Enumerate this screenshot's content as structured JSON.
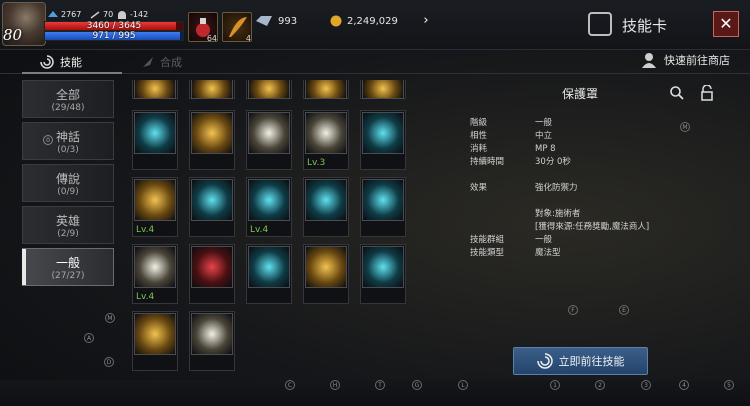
{
  "player": {
    "level": "80",
    "hp": "3460 / 3645",
    "hp_fraction": 0.95,
    "mp": "971 / 995",
    "mp_fraction": 0.98,
    "stat_a": "2767",
    "stat_b": "70",
    "stat_c": "-142"
  },
  "potions": [
    {
      "count": "64",
      "color": "#b0272b"
    },
    {
      "count": "4",
      "color": "#b8741f"
    }
  ],
  "currency": {
    "gems": "993",
    "gold": "2,249,029"
  },
  "window": {
    "title": "技能卡",
    "close": "✕"
  },
  "tabs": {
    "skills": "技能",
    "craft": "合成",
    "shop": "快速前往商店"
  },
  "sidebar": [
    {
      "name": "全部",
      "count": "(29/48)"
    },
    {
      "name": "神話",
      "count": "(0/3)",
      "badge": "0"
    },
    {
      "name": "傳說",
      "count": "(0/9)"
    },
    {
      "name": "英雄",
      "count": "(2/9)"
    },
    {
      "name": "一般",
      "count": "(27/27)",
      "selected": true
    }
  ],
  "cards": [
    {
      "icon": "skill-partial-icon-1",
      "tone": "gold",
      "lv": ""
    },
    {
      "icon": "skill-partial-icon-2",
      "tone": "gold",
      "lv": ""
    },
    {
      "icon": "skill-partial-icon-3",
      "tone": "gold",
      "lv": ""
    },
    {
      "icon": "skill-partial-icon-4",
      "tone": "gold",
      "lv": ""
    },
    {
      "icon": "skill-partial-icon-5",
      "tone": "gold",
      "lv": ""
    },
    {
      "icon": "cycle-arrows-icon",
      "tone": "cyan",
      "lv": ""
    },
    {
      "icon": "crown-sparkle-icon",
      "tone": "gold",
      "lv": ""
    },
    {
      "icon": "winged-heart-icon",
      "tone": "white",
      "lv": ""
    },
    {
      "icon": "guardian-shield-icon",
      "tone": "white",
      "lv": "Lv.3"
    },
    {
      "icon": "glowing-sword-icon",
      "tone": "cyan",
      "lv": ""
    },
    {
      "icon": "sword-burst-icon",
      "tone": "gold",
      "lv": "Lv.4"
    },
    {
      "icon": "sun-gear-icon",
      "tone": "cyan",
      "lv": ""
    },
    {
      "icon": "whirlwind-icon",
      "tone": "cyan",
      "lv": "Lv.4"
    },
    {
      "icon": "cross-shield-icon",
      "tone": "cyan",
      "lv": ""
    },
    {
      "icon": "sword-clock-icon",
      "tone": "cyan",
      "lv": ""
    },
    {
      "icon": "holy-sword-icon",
      "tone": "white",
      "lv": "Lv.4"
    },
    {
      "icon": "red-book-icon",
      "tone": "red",
      "lv": ""
    },
    {
      "icon": "blue-book-icon",
      "tone": "cyan",
      "lv": ""
    },
    {
      "icon": "fire-orb-icon",
      "tone": "gold",
      "lv": ""
    },
    {
      "icon": "scroll-swirl-icon",
      "tone": "cyan",
      "lv": ""
    },
    {
      "icon": "rune-stone-icon",
      "tone": "gold",
      "lv": ""
    },
    {
      "icon": "holy-cross-icon",
      "tone": "white",
      "lv": ""
    }
  ],
  "detail": {
    "title": "保護罩",
    "rows": [
      {
        "k": "階級",
        "v": "一般"
      },
      {
        "k": "相性",
        "v": "中立"
      },
      {
        "k": "消耗",
        "v": "MP 8"
      },
      {
        "k": "持續時間",
        "v": "30分 0秒"
      }
    ],
    "effect_label": "效果",
    "effect_value": "強化防禦力",
    "target": "對象:施術者",
    "acquire": "[獲得來源:任務獎勵,魔法商人]",
    "rows2": [
      {
        "k": "技能群組",
        "v": "一般"
      },
      {
        "k": "技能類型",
        "v": "魔法型"
      }
    ],
    "goto": "立即前往技能"
  },
  "markers": [
    "C",
    "H",
    "T",
    "G",
    "L",
    "1",
    "2",
    "3",
    "4",
    "5",
    "M",
    "A",
    "D",
    "E",
    "F",
    "M"
  ]
}
